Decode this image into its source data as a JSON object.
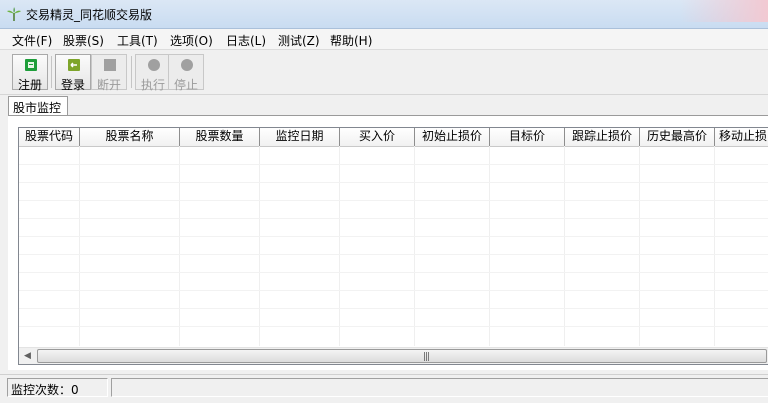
{
  "window": {
    "title": "交易精灵_同花顺交易版"
  },
  "menu": [
    {
      "label": "文件(F)"
    },
    {
      "label": "股票(S)"
    },
    {
      "label": "工具(T)"
    },
    {
      "label": "选项(O)"
    },
    {
      "label": "日志(L)"
    },
    {
      "label": "测试(Z)"
    },
    {
      "label": "帮助(H)"
    }
  ],
  "toolbar": {
    "register_label": "注册",
    "login_label": "登录",
    "disconnect_label": "断开",
    "execute_label": "执行",
    "stop_label": "停止",
    "register_icon": "register-icon",
    "login_icon": "login-icon",
    "disconnect_icon": "disconnect-icon",
    "execute_icon": "execute-icon",
    "stop_icon": "stop-icon"
  },
  "tabs": [
    {
      "label": "股市监控"
    }
  ],
  "table": {
    "columns": [
      "股票代码",
      "股票名称",
      "股票数量",
      "监控日期",
      "买入价",
      "初始止损价",
      "目标价",
      "跟踪止损价",
      "历史最高价",
      "移动止损"
    ],
    "rows": []
  },
  "status": {
    "monitor_count": "监控次数：0"
  },
  "colors": {
    "title_bar": "#dbe7f5",
    "register_icon": "#1e9e3a",
    "login_icon": "#6a8f1c",
    "disabled": "#a0a0a0"
  }
}
